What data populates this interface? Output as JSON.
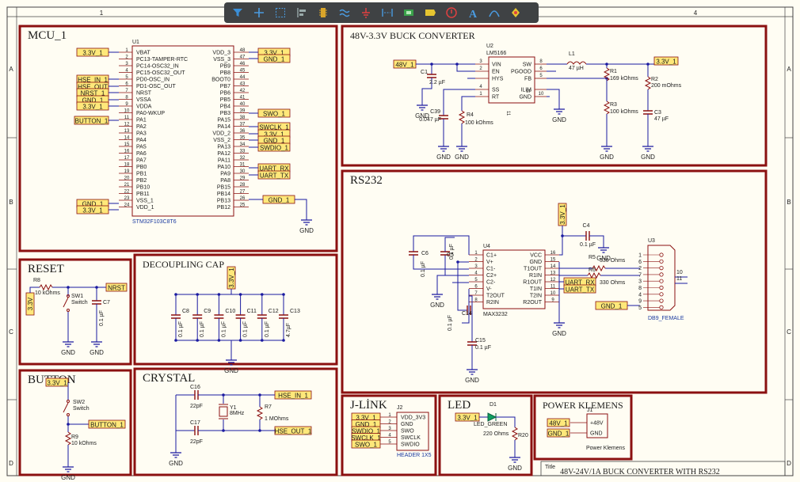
{
  "toolbar": {
    "tools": [
      {
        "icon": "filter-icon"
      },
      {
        "icon": "plus-crosshair-icon"
      },
      {
        "icon": "select-rect-icon"
      },
      {
        "icon": "align-icon"
      },
      {
        "icon": "component-icon"
      },
      {
        "icon": "wire-icon"
      },
      {
        "icon": "ground-icon"
      },
      {
        "icon": "bus-icon"
      },
      {
        "icon": "chip-icon"
      },
      {
        "icon": "netlabel-icon"
      },
      {
        "icon": "port-icon"
      },
      {
        "icon": "text-icon"
      },
      {
        "icon": "arc-icon"
      },
      {
        "icon": "bulb-icon"
      }
    ]
  },
  "border": {
    "cols": [
      "1",
      "4"
    ],
    "rows": [
      "A",
      "B",
      "C",
      "D"
    ]
  },
  "blocks": {
    "mcu": "MCU_1",
    "buck": "48V-3.3V BUCK CONVERTER",
    "rs232": "RS232",
    "reset": "RESET",
    "decoupling": "DECOUPLING CAP",
    "button": "BUTTON",
    "crystal": "CRYSTAL",
    "jlink": "J-LİNK",
    "led": "LED",
    "power": "POWER KLEMENS"
  },
  "mcu": {
    "ref": "U1",
    "part": "STM32F103C8T6",
    "left_pins": [
      "VBAT",
      "PC13-TAMPER-RTC",
      "PC14-OSC32_IN",
      "PC15-OSC32_OUT",
      "PD0-OSC_IN",
      "PD1-OSC_OUT",
      "NRST",
      "VSSA",
      "VDDA",
      "PA0-WKUP",
      "PA1",
      "PA2",
      "PA3",
      "PA4",
      "PA5",
      "PA6",
      "PA7",
      "PB0",
      "PB1",
      "PB2",
      "PB10",
      "PB11",
      "VSS_1",
      "VDD_1"
    ],
    "left_nums": [
      "1",
      "2",
      "3",
      "4",
      "5",
      "6",
      "7",
      "8",
      "9",
      "10",
      "11",
      "12",
      "13",
      "14",
      "15",
      "16",
      "17",
      "18",
      "19",
      "20",
      "21",
      "22",
      "23",
      "24"
    ],
    "right_pins": [
      "VDD_3",
      "VSS_3",
      "PB9",
      "PB8",
      "BOOT0",
      "PB7",
      "PB6",
      "PB5",
      "PB4",
      "PB3",
      "PA15",
      "PA14",
      "VDD_2",
      "VSS_2",
      "PA13",
      "PA12",
      "PA11",
      "PA10",
      "PA9",
      "PA8",
      "PB15",
      "PB14",
      "PB13",
      "PB12"
    ],
    "right_nums": [
      "48",
      "47",
      "46",
      "45",
      "44",
      "43",
      "42",
      "41",
      "40",
      "39",
      "38",
      "37",
      "36",
      "35",
      "34",
      "33",
      "32",
      "31",
      "30",
      "29",
      "28",
      "27",
      "26",
      "25"
    ],
    "left_labels": [
      "3.3V_1",
      "HSE_IN_1",
      "HSE_OUT",
      "NRST_1",
      "GND_1",
      "3.3V_1",
      "BUTTON_1",
      "GND_1",
      "3.3V_1"
    ],
    "right_labels": [
      "3.3V_1",
      "GND_1",
      "SWO_1",
      "SWCLK_1",
      "3.3V_1",
      "GND_1",
      "SWDIO_1",
      "UART_RX",
      "UART_TX",
      "GND_1"
    ],
    "gnd": "GND"
  },
  "buck": {
    "ref": "U2",
    "part": "LM5166",
    "in_label": "48V_1",
    "out_label": "3.3V_1",
    "pins_left": [
      "VIN",
      "EN",
      "HYS",
      "SS",
      "RT"
    ],
    "pins_right": [
      "SW",
      "PGOOD",
      "FB",
      "ILIM",
      "GND"
    ],
    "nums_left": [
      "3",
      "2",
      "4",
      "1"
    ],
    "nums_right": [
      "8",
      "6",
      "5",
      "10"
    ],
    "ep": "EP",
    "eleven": "11",
    "L1": "L1",
    "L1v": "47 µH",
    "C1": "C1",
    "C1v": "2.2 µF",
    "C39": "C39",
    "C39v": "0.047 µF",
    "R4": "R4",
    "R4v": "100 kOhms",
    "R1": "R1",
    "R1v": "169 kOhms",
    "R3": "R3",
    "R3v": "100 kOhms",
    "R2": "R2",
    "R2v": "200 mOhms",
    "C3": "C3",
    "C3v": "47 µF",
    "gnd": "GND"
  },
  "rs232": {
    "ref": "U4",
    "part": "MAX3232",
    "pins_left": [
      "C1+",
      "V+",
      "C1-",
      "C2+",
      "C2-",
      "V-",
      "T2OUT",
      "R2IN"
    ],
    "pins_right": [
      "VCC",
      "GND",
      "T1OUT",
      "R1IN",
      "R1OUT",
      "T1IN",
      "T2IN",
      "R2OUT"
    ],
    "nums_left": [
      "1",
      "2",
      "3",
      "4",
      "5",
      "6",
      "7",
      "8"
    ],
    "nums_right": [
      "16",
      "15",
      "14",
      "13",
      "12",
      "11",
      "10",
      "9"
    ],
    "C4": "C4",
    "C4v": "0.1 µF",
    "C5": "C5",
    "C5v": "0.1 µF",
    "C6": "C6",
    "C6v": "0.1 µF",
    "C14": "C14",
    "C14v": "0.1 µF",
    "C15": "C15",
    "C15v": "0.1 µF",
    "R5": "R5",
    "R5v": "330 Ohms",
    "R6": "R6",
    "R6v": "330 Ohms",
    "U3": "U3",
    "conn": "DB9_FEMALE",
    "conn_pins": [
      "1",
      "6",
      "2",
      "7",
      "3",
      "8",
      "4",
      "9",
      "5"
    ],
    "ten": "10",
    "eleven": "11",
    "labels": [
      "3.3V_1",
      "UART_RX",
      "UART_TX",
      "GND_1"
    ],
    "gnd": "GND"
  },
  "reset": {
    "R": "R8",
    "Rv": "10 kOhms",
    "SW": "SW1",
    "SWv": "Switch",
    "C": "C7",
    "Cv": "0.1 µF",
    "v": "3.3V",
    "label": "NRST",
    "gnd": "GND"
  },
  "decoupling": {
    "caps": [
      "C8",
      "C9",
      "C10",
      "C11",
      "C12",
      "C13"
    ],
    "vals": [
      "0.1 µF",
      "0.1 µF",
      "0.1 µF",
      "0.1 µF",
      "0.1 µF",
      "4.7µF"
    ],
    "v": "3.3V_1",
    "gnd": "GND"
  },
  "button": {
    "v": "3.3V_1",
    "SW": "SW2",
    "SWv": "Switch",
    "R": "R9",
    "Rv": "10 kOhms",
    "label": "BUTTON_1",
    "gnd": "GND"
  },
  "crystal": {
    "C16": "C16",
    "C16v": "22pF",
    "C17": "C17",
    "C17v": "22pF",
    "Y": "Y1",
    "Yv": "8MHz",
    "R": "R7",
    "Rv": "1 MOhms",
    "l1": "HSE_IN_1",
    "l2": "HSE_OUT_1",
    "gnd": "GND"
  },
  "jlink": {
    "ref": "J2",
    "part": "HEADER 1X5",
    "pins": [
      "VDD_3V3",
      "GND",
      "SWO",
      "SWCLK",
      "SWDIO"
    ],
    "nums": [
      "1",
      "2",
      "3",
      "4",
      "5"
    ],
    "labels": [
      "3.3V_1",
      "GND_1",
      "SWDIO_1",
      "SWCLK_1",
      "SWO_1"
    ]
  },
  "led": {
    "ref": "D1",
    "part": "LED_GREEN",
    "v": "3.3V_1",
    "R": "R20",
    "Rv": "220 Ohms",
    "gnd": "GND"
  },
  "power": {
    "ref": "J1",
    "part": "Power Klemens",
    "pins": [
      "+48V",
      "GND"
    ],
    "labels": [
      "48V_1",
      "GND_1"
    ]
  },
  "title_block": {
    "label": "Title",
    "title": "48V-24V/1A BUCK CONVERTER WITH RS232"
  },
  "colors": {
    "block": "#8b1010",
    "wire": "#1a1aa0",
    "label_fill": "#ffe87a",
    "comp": "#8b1010",
    "text": "#202020"
  }
}
